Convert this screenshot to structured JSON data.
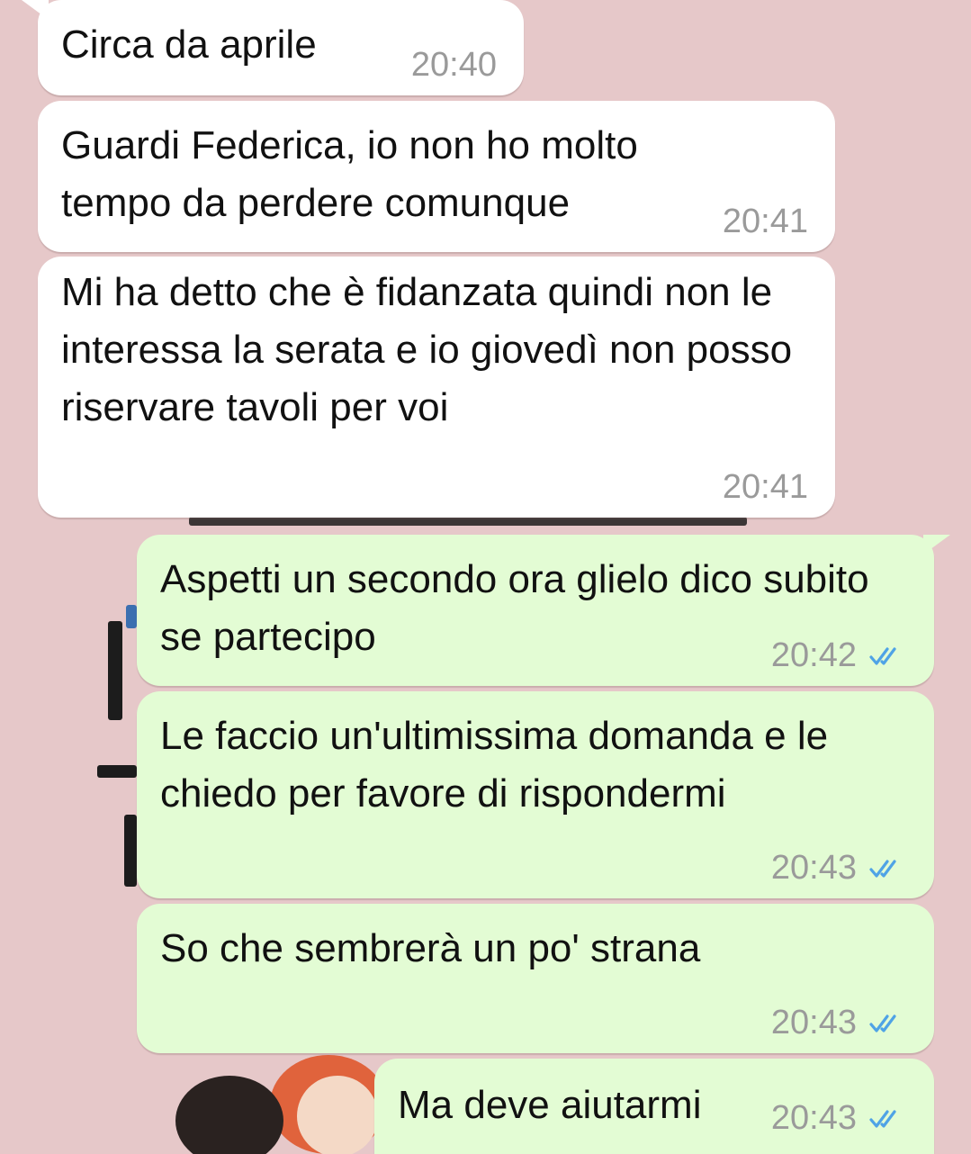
{
  "colors": {
    "background": "#e6c8c9",
    "incoming_bubble": "#ffffff",
    "outgoing_bubble": "#e3fcd4",
    "timestamp": "#9a9a9a",
    "read_ticks": "#4fa3e6"
  },
  "messages": [
    {
      "direction": "incoming",
      "text": "Circa da aprile",
      "time": "20:40"
    },
    {
      "direction": "incoming",
      "text": "Guardi Federica, io non ho molto tempo da perdere comunque",
      "time": "20:41"
    },
    {
      "direction": "incoming",
      "text": "Mi ha detto che è fidanzata quindi non le interessa la serata e io giovedì non posso riservare tavoli per voi",
      "time": "20:41"
    },
    {
      "direction": "outgoing",
      "text": "Aspetti un secondo ora glielo dico subito se partecipo",
      "time": "20:42",
      "status_icon": "double-check-read-icon"
    },
    {
      "direction": "outgoing",
      "text": "Le faccio un'ultimissima domanda e le chiedo per favore di rispondermi",
      "time": "20:43",
      "status_icon": "double-check-read-icon"
    },
    {
      "direction": "outgoing",
      "text": "So che sembrerà un po' strana",
      "time": "20:43",
      "status_icon": "double-check-read-icon"
    },
    {
      "direction": "outgoing",
      "text": "Ma deve aiutarmi",
      "time": "20:43",
      "status_icon": "double-check-read-icon"
    }
  ]
}
